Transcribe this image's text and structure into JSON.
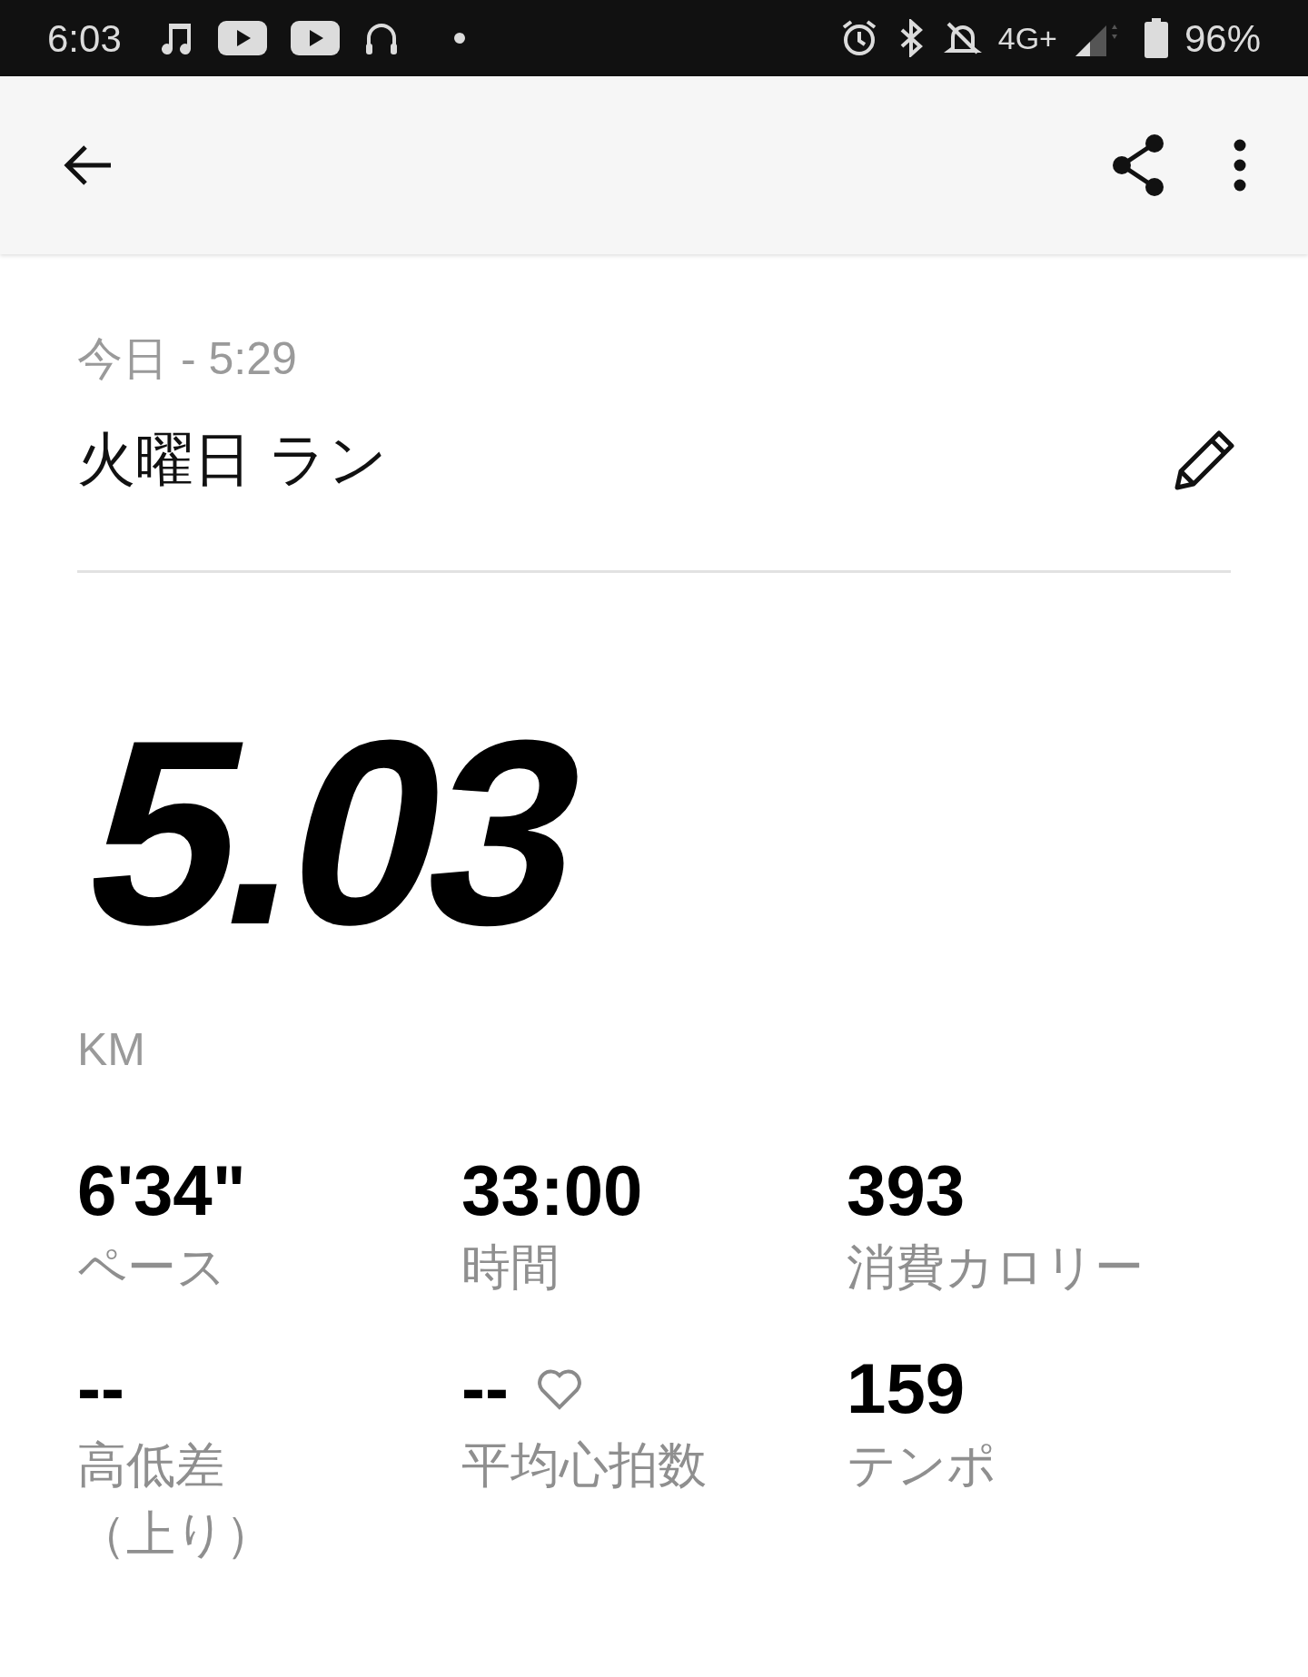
{
  "status_bar": {
    "time": "6:03",
    "network": "4G+",
    "battery": "96%"
  },
  "activity": {
    "date": "今日 - 5:29",
    "title": "火曜日 ラン",
    "distance": "5.03",
    "unit": "KM"
  },
  "stats": [
    {
      "kind": "plain",
      "value": "6'34\"",
      "label": "ペース"
    },
    {
      "kind": "plain",
      "value": "33:00",
      "label": "時間"
    },
    {
      "kind": "plain",
      "value": "393",
      "label": "消費カロリー"
    },
    {
      "kind": "plain",
      "value": "--",
      "label": "高低差（上り）"
    },
    {
      "kind": "heart_rate",
      "value": "--",
      "label": "平均心拍数"
    },
    {
      "kind": "plain",
      "value": "159",
      "label": "テンポ"
    }
  ]
}
